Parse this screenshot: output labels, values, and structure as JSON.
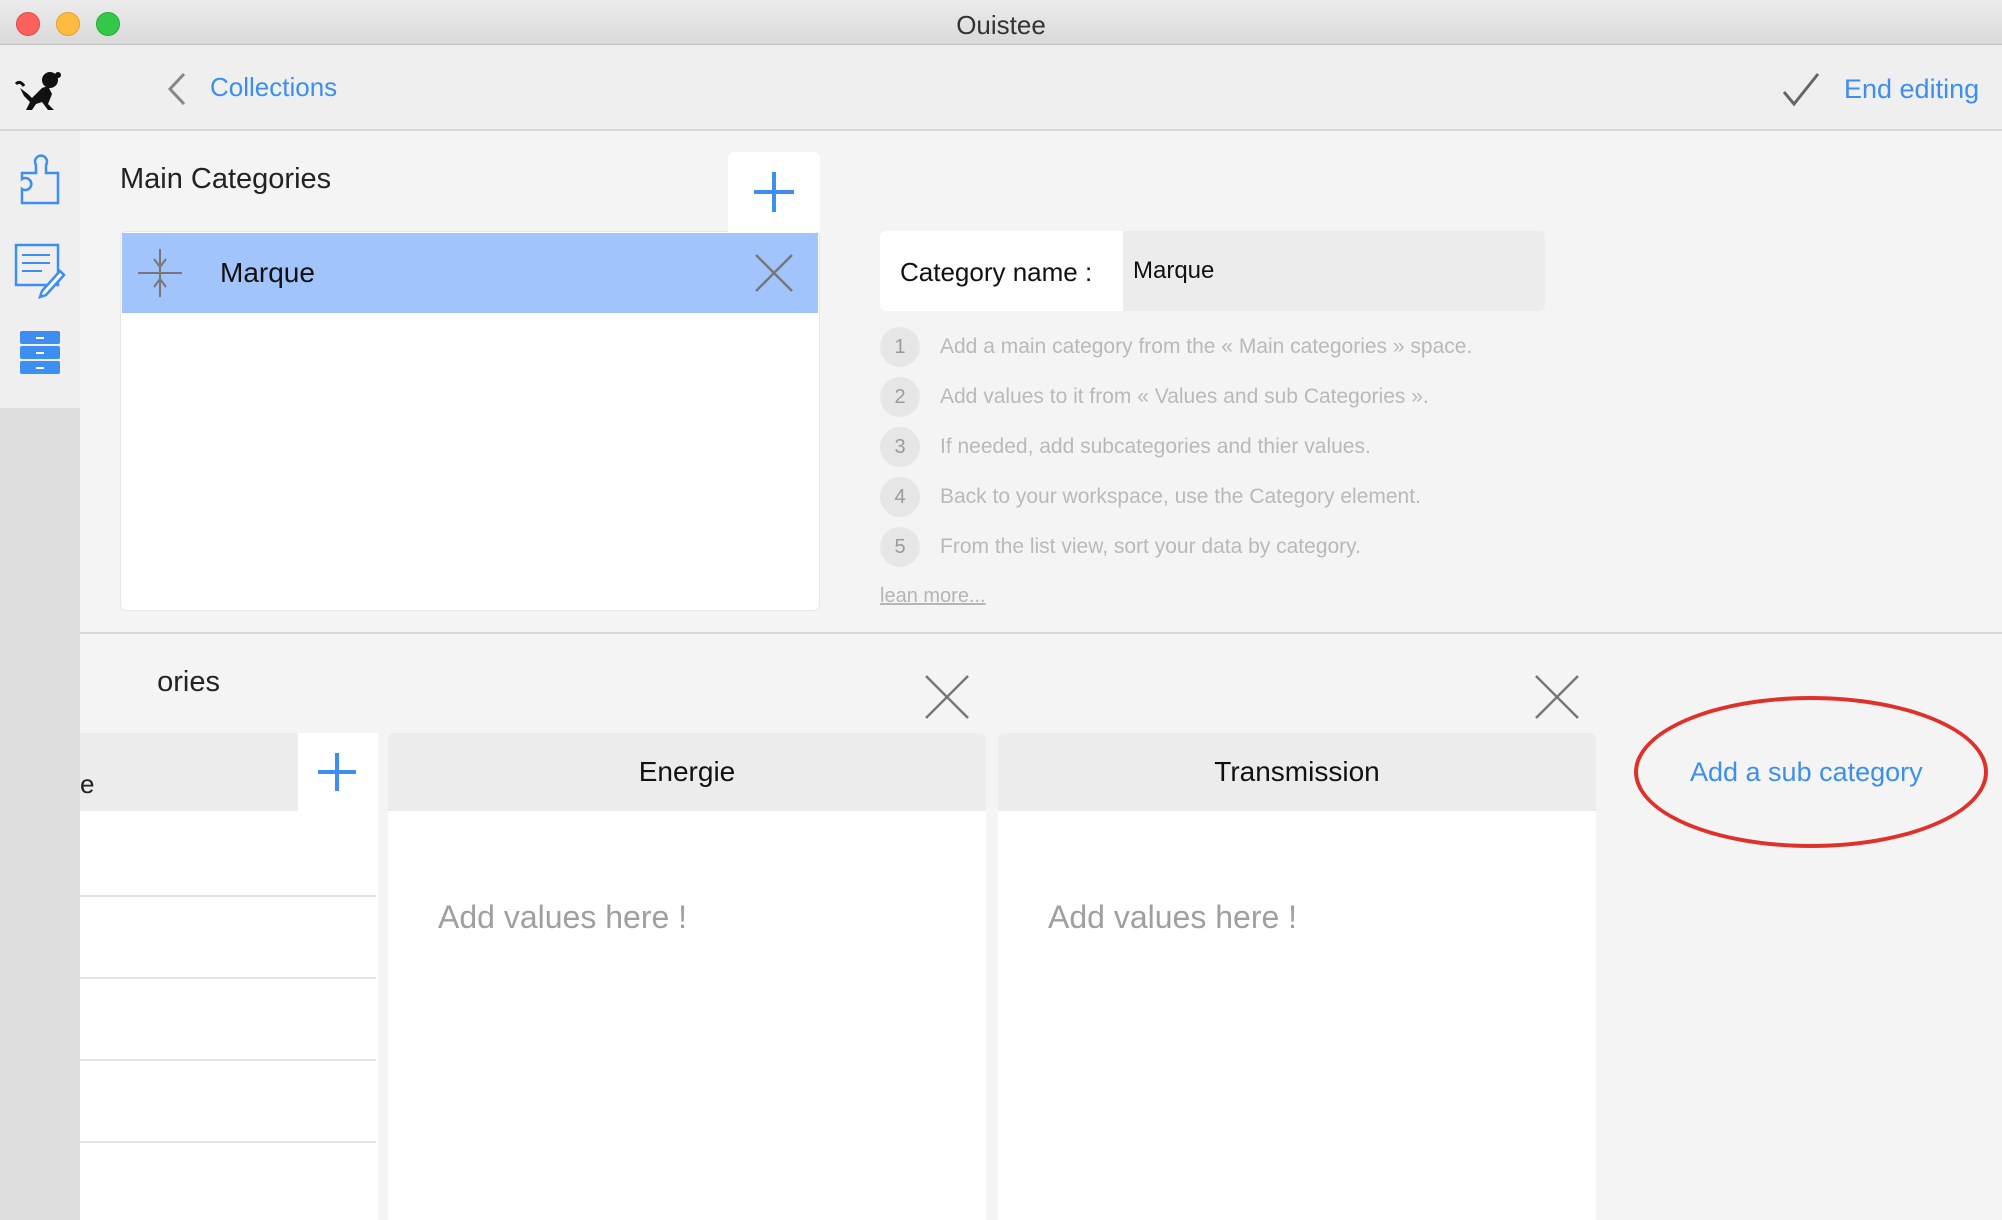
{
  "window": {
    "title": "Ouistee"
  },
  "toolbar": {
    "back_label": "Collections",
    "end_label": "End editing"
  },
  "main_categories": {
    "title": "Main Categories",
    "items": [
      {
        "label": "Marque",
        "selected": true
      }
    ]
  },
  "category_name": {
    "label": "Category name :",
    "value": "Marque"
  },
  "steps": [
    {
      "num": "1",
      "text": "Add a main category from the « Main categories » space."
    },
    {
      "num": "2",
      "text": "Add values to it from « Values and sub Categories »."
    },
    {
      "num": "3",
      "text": "If needed, add subcategories and thier values."
    },
    {
      "num": "4",
      "text": "Back to your workspace, use the Category element."
    },
    {
      "num": "5",
      "text": "From the list view, sort your data by category."
    }
  ],
  "learn_more": "lean more...",
  "values_section": {
    "title_visible": "ories",
    "first_column_header_visible": "e",
    "sub_columns": [
      {
        "title": "Energie",
        "placeholder": "Add values here !"
      },
      {
        "title": "Transmission",
        "placeholder": "Add values here !"
      }
    ],
    "add_sub_label": "Add a sub category"
  },
  "colors": {
    "accent": "#3d8ef0",
    "selected_row": "#a0c4fb",
    "highlight_ring": "#e0302a"
  },
  "icons": {
    "logo": "monkey-logo-icon",
    "back": "chevron-left-icon",
    "end": "checkmark-icon",
    "sidebar": [
      "puzzle-icon",
      "edit-document-icon",
      "drawers-icon"
    ],
    "drag": "drag-handle-icon",
    "delete": "close-icon",
    "add": "plus-icon"
  }
}
